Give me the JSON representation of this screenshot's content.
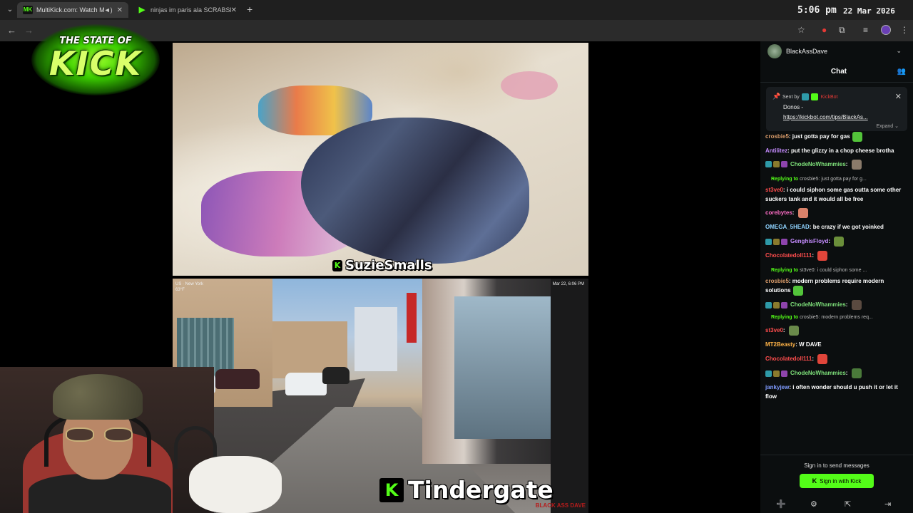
{
  "browser": {
    "tabs": [
      {
        "title": "MultiKick.com: Watch Multi",
        "favicon": "MK",
        "active": true
      },
      {
        "title": "ninjas im paris ala SCRABSNYC",
        "favicon": "▶",
        "active": false
      }
    ],
    "clock": "5:06 pm",
    "date": "22 Mar 2026"
  },
  "overlay": {
    "logo_small": "THE STATE OF",
    "logo_big": "KICK"
  },
  "streams": {
    "top": {
      "name": "SuzieSmalls",
      "badge": "K"
    },
    "bottom": {
      "name": "Tindergate",
      "badge": "K",
      "osd_location": "US · New York",
      "osd_temp": "63°F",
      "osd_time": "Mar 22, 6:06 PM",
      "brand": "BLACK ASS DAVE"
    }
  },
  "chat": {
    "channel": "BlackAssDave",
    "title": "Chat",
    "pinned": {
      "sent_by": "Sent by",
      "bot": "KickBot",
      "text": "Donos -",
      "link": "https://kickbot.com/tips/BlackAs...",
      "expand": "Expand"
    },
    "messages": [
      {
        "user": "crosbie5",
        "color": "#d89b6a",
        "text": "just gotta pay for gas",
        "emote": "#53c43a"
      },
      {
        "user": "Antilitez",
        "color": "#c58cff",
        "text": "put the glizzy in a chop cheese brotha"
      },
      {
        "user": "ChodeNoWhammies",
        "color": "#7ee07a",
        "badges": true,
        "emote": "#8a7a6a",
        "text": ""
      },
      {
        "reply_to": "Replying to",
        "reply_target": "crosbie5: just gotta pay for g...",
        "user": "st3ve0",
        "color": "#ff4d4d",
        "text": "i could siphon some gas outta some other suckers tank and it would all be free"
      },
      {
        "user": "corebytes",
        "color": "#ff6ec7",
        "emote": "#d9826a",
        "text": ""
      },
      {
        "user": "OMEGA_5HEAD",
        "color": "#8fd3ff",
        "text": "be crazy if we got yoinked"
      },
      {
        "user": "GenghisFloyd",
        "color": "#c58cff",
        "badges": true,
        "emote": "#6b8f3a",
        "text": ""
      },
      {
        "user": "Chocolatedoll111",
        "color": "#ff4d4d",
        "emote": "#e0453a",
        "text": ""
      },
      {
        "reply_to": "Replying to",
        "reply_target": "st3ve0: i could siphon some ...",
        "user": "crosbie5",
        "color": "#d89b6a",
        "text": "modern problems require modern solutions",
        "emote": "#53c43a"
      },
      {
        "user": "ChodeNoWhammies",
        "color": "#7ee07a",
        "badges": true,
        "emote": "#5a4a40",
        "text": ""
      },
      {
        "reply_to": "Replying to",
        "reply_target": "crosbie5: modern problems req...",
        "user": "st3ve0",
        "color": "#ff4d4d",
        "emote": "#6a8a4a",
        "text": ""
      },
      {
        "user": "MT2Beasty",
        "color": "#ffb347",
        "text": "W DAVE"
      },
      {
        "user": "Chocolatedoll111",
        "color": "#ff4d4d",
        "emote": "#e0453a",
        "text": ""
      },
      {
        "user": "ChodeNoWhammies",
        "color": "#7ee07a",
        "badges": true,
        "emote": "#4a7a3a",
        "text": ""
      },
      {
        "user": "jankyjew",
        "color": "#7f9bff",
        "text": "i often wonder should u push it or let it flow"
      }
    ],
    "footer": {
      "signin_text": "Sign in to send messages",
      "signin_button": "Sign in with Kick",
      "signin_badge": "K"
    }
  }
}
